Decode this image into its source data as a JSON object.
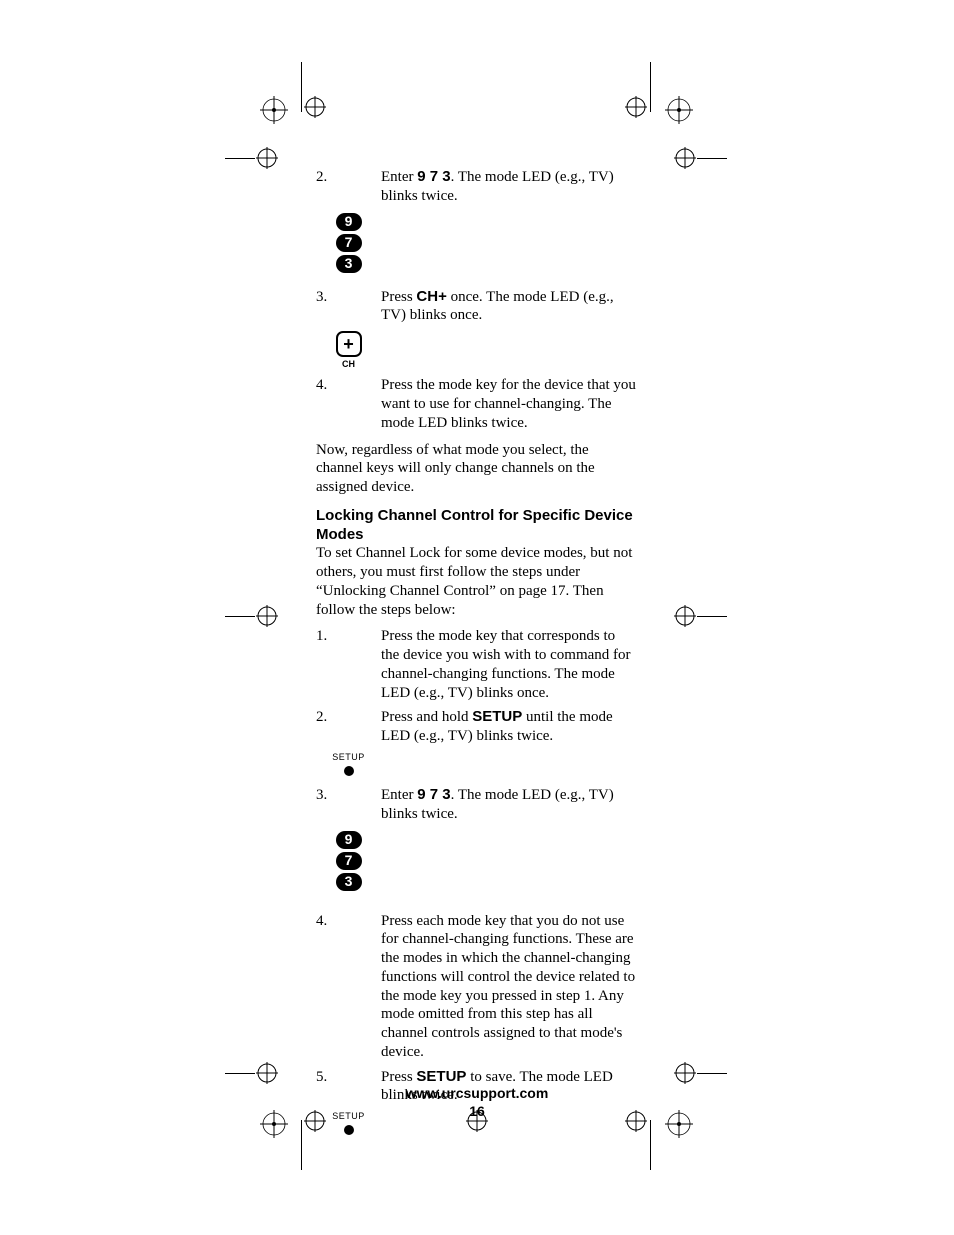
{
  "footer": {
    "url": "www.urcsupport.com",
    "page": "16"
  },
  "step_a2": {
    "num": "2.",
    "text_before": "Enter ",
    "code": "9  7  3",
    "text_after": ". The mode LED (e.g., TV) blinks twice.",
    "keys": {
      "k1": "9",
      "k2": "7",
      "k3": "3"
    }
  },
  "step_a3": {
    "num": "3.",
    "text_before": "Press ",
    "bold": "CH+",
    "text_after": " once. The mode LED (e.g., TV) blinks once.",
    "ch_plus": "+",
    "ch_label": "CH"
  },
  "step_a4": {
    "num": "4.",
    "text": "Press the mode key for the device that you want to use for channel-changing.  The mode LED blinks twice."
  },
  "para1": "Now, regardless of what mode you select, the channel keys will only change channels on the assigned device.",
  "heading": "Locking Channel Control for Specific Device Modes",
  "para2": "To set Channel Lock for some device modes, but not others, you must first follow the steps under “Unlocking Channel Control” on page 17. Then follow the steps below:",
  "step_b1": {
    "num": "1.",
    "text": "Press the mode key that corresponds to the device you wish with to command for channel-changing functions. The mode LED (e.g., TV) blinks once."
  },
  "step_b2": {
    "num": "2.",
    "text_before": "Press and hold ",
    "bold": "SETUP",
    "text_after": " until the mode LED (e.g., TV) blinks twice.",
    "setup_label": "SETUP"
  },
  "step_b3": {
    "num": "3.",
    "text_before": "Enter ",
    "code": "9  7  3",
    "text_after": ". The mode LED (e.g., TV) blinks twice.",
    "keys": {
      "k1": "9",
      "k2": "7",
      "k3": "3"
    }
  },
  "step_b4": {
    "num": "4.",
    "text": "Press each mode key that you do not use for channel-changing functions. These are the modes in which the channel-changing functions will control the device related to the mode key you pressed in step 1.  Any mode omitted from this step has all channel controls assigned to that mode's device."
  },
  "step_b5": {
    "num": "5.",
    "text_before": "Press ",
    "bold": "SETUP",
    "text_after": " to save. The mode LED blinks twice.",
    "setup_label": "SETUP"
  }
}
